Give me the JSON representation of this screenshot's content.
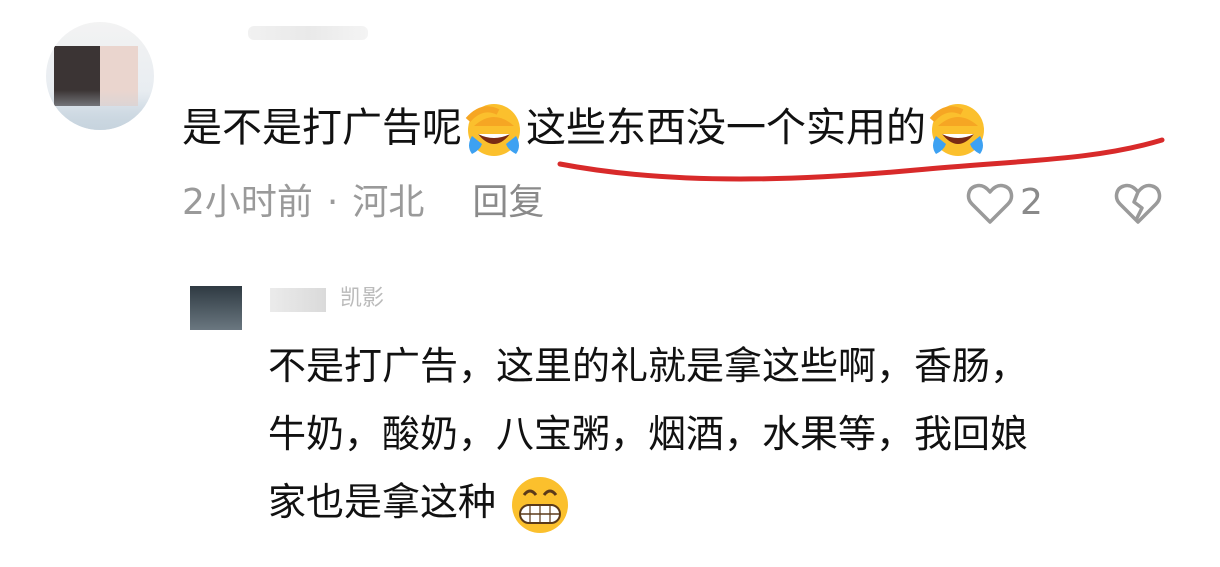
{
  "comment": {
    "text_part1": "是不是打广告呢",
    "emoji_1": "laughing-tears-emoji",
    "text_part2": "这些东西没一个实用的",
    "emoji_2": "laughing-tears-emoji",
    "time": "2小时前",
    "separator": "·",
    "location": "河北",
    "reply_label": "回复",
    "like_icon": "heart-outline-icon",
    "like_count": "2",
    "dislike_icon": "broken-heart-icon",
    "annotation_color": "#d82a2a"
  },
  "reply": {
    "username": "凯影",
    "line1": "不是打广告，这里的礼就是拿这些啊，香肠，",
    "line2": "牛奶，酸奶，八宝粥，烟酒，水果等，我回娘",
    "line3": "家也是拿这种",
    "emoji": "grinning-teeth-emoji"
  }
}
